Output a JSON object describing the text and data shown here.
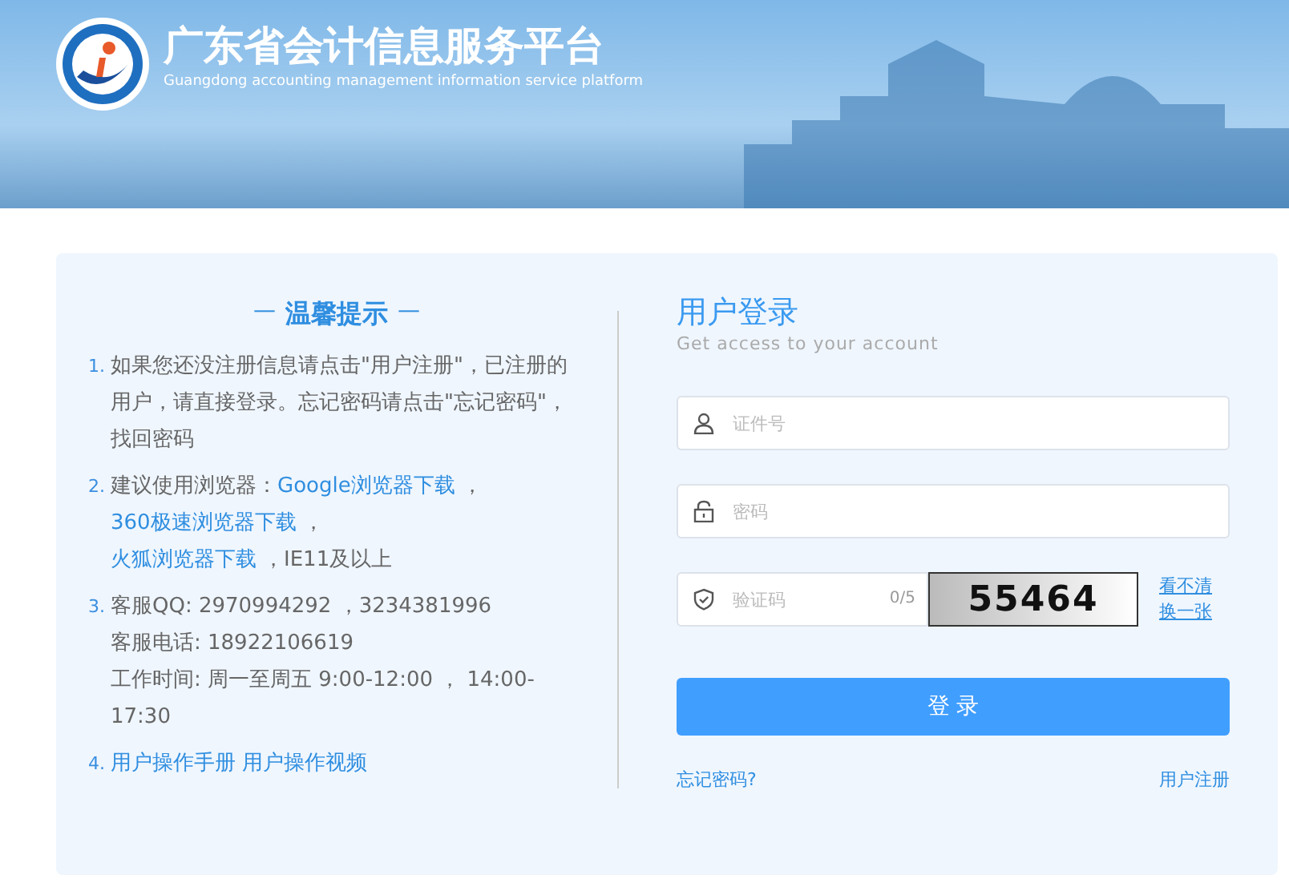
{
  "header": {
    "title": "广东省会计信息服务平台",
    "subtitle": "Guangdong accounting management information service platform"
  },
  "tips": {
    "title": "温馨提示",
    "dash": "—",
    "items": [
      {
        "number": "1.",
        "segments": [
          {
            "kind": "text",
            "text": "如果您还没注册信息请点击\"用户注册\"，已注册的用户，请直接登录。忘记密码请点击\"忘记密码\"，找回密码"
          }
        ]
      },
      {
        "number": "2.",
        "segments": [
          {
            "kind": "text",
            "text": "建议使用浏览器："
          },
          {
            "kind": "link",
            "text": "Google浏览器下载"
          },
          {
            "kind": "text",
            "text": "，"
          },
          {
            "kind": "link",
            "text": "360极速浏览器下载"
          },
          {
            "kind": "text",
            "text": "，"
          },
          {
            "kind": "link",
            "text": "火狐浏览器下载"
          },
          {
            "kind": "text",
            "text": "，IE11及以上"
          }
        ]
      },
      {
        "number": "3.",
        "segments": [
          {
            "kind": "line",
            "text": "客服QQ: 2970994292 ，3234381996"
          },
          {
            "kind": "line",
            "text": "客服电话: 18922106619"
          },
          {
            "kind": "line",
            "text": "工作时间: 周一至周五 9:00-12:00 ， 14:00-17:30"
          }
        ]
      },
      {
        "number": "4.",
        "segments": [
          {
            "kind": "link",
            "text": "用户操作手册"
          },
          {
            "kind": "link",
            "text": "用户操作视频"
          }
        ]
      }
    ]
  },
  "login": {
    "title": "用户登录",
    "subtitle": "Get access to your account",
    "fields": [
      {
        "kind": "user",
        "placeholder": "证件号"
      },
      {
        "kind": "lock",
        "placeholder": "密码"
      }
    ],
    "captcha": {
      "placeholder": "验证码",
      "counter": "0/5",
      "image_text": "55464",
      "refresh_links": [
        "看不清",
        "换一张"
      ]
    },
    "submit": "登 录",
    "forgot": "忘记密码?",
    "register": "用户注册"
  }
}
